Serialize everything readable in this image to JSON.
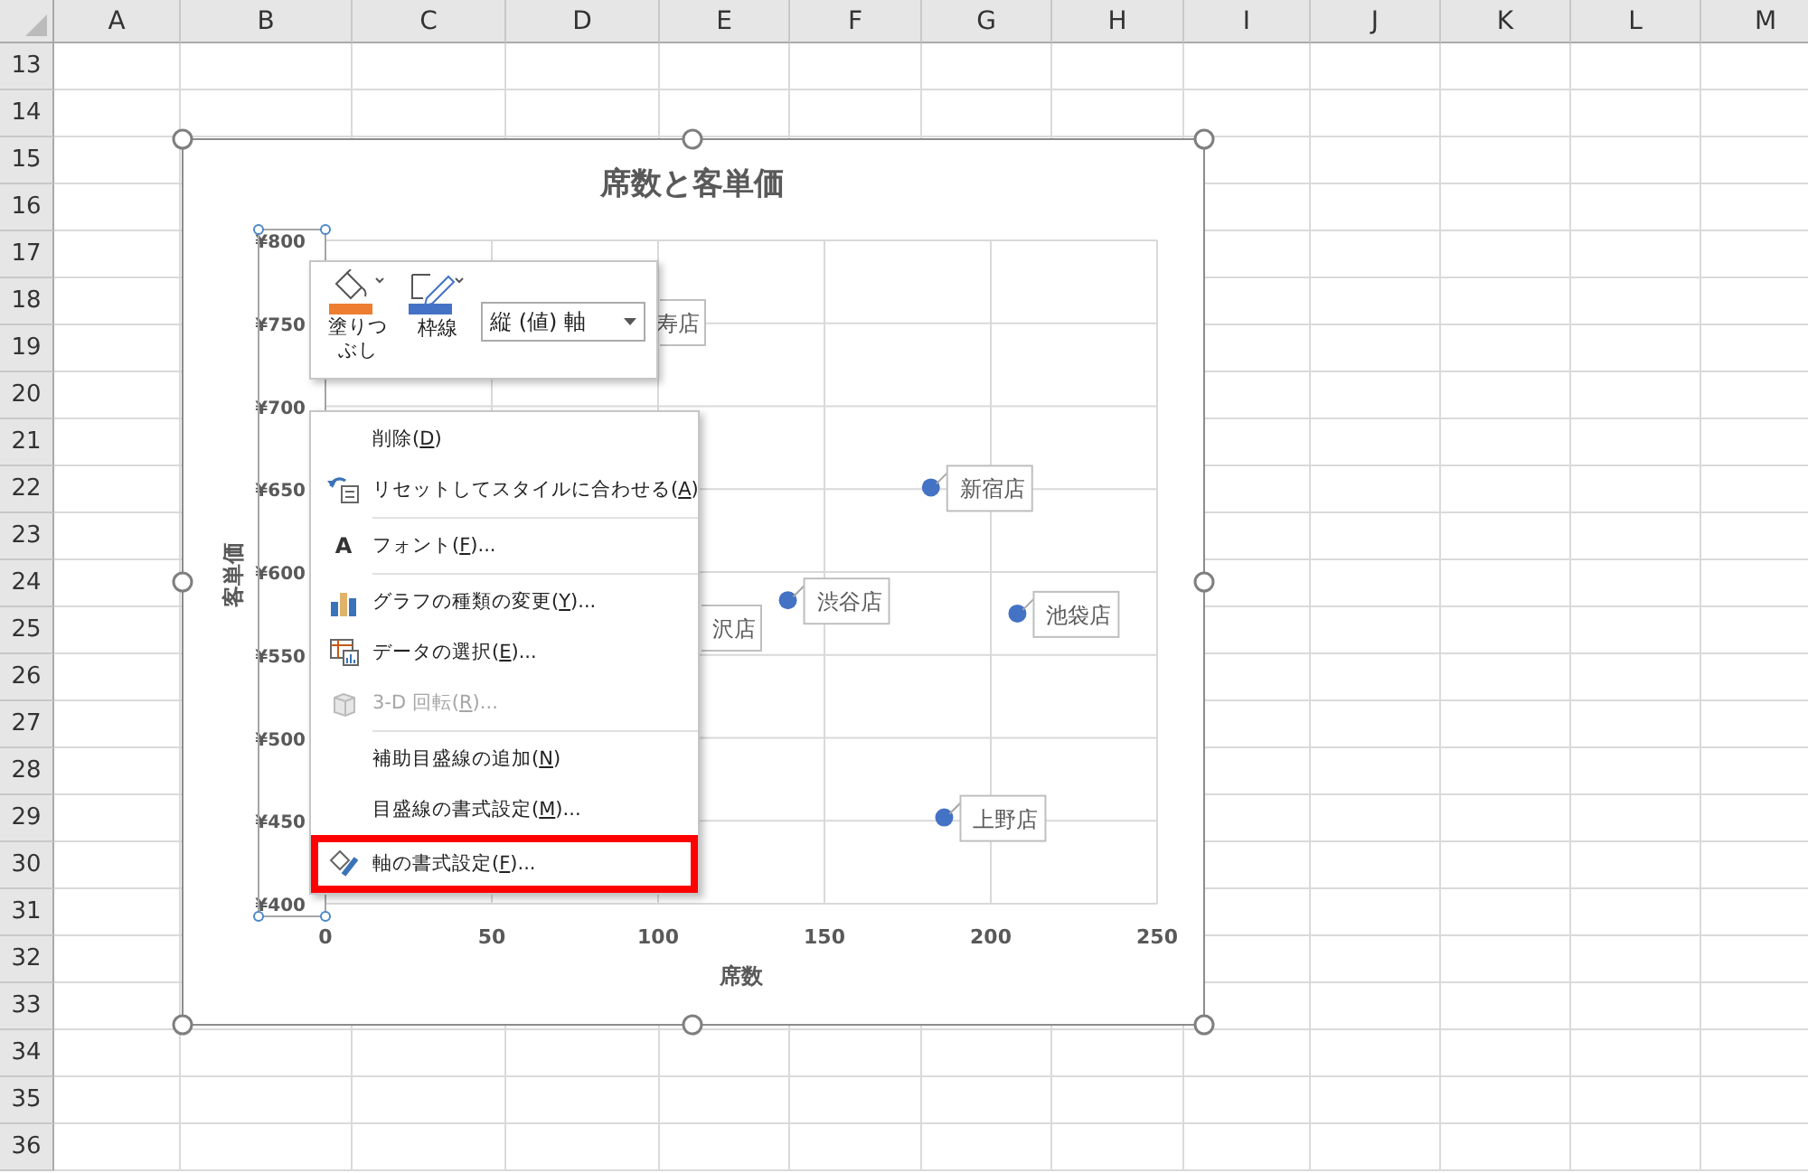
{
  "sheet": {
    "columns": [
      "A",
      "B",
      "C",
      "D",
      "E",
      "F",
      "G",
      "H",
      "I",
      "J",
      "K",
      "L",
      "M"
    ],
    "rows": [
      "13",
      "14",
      "15",
      "16",
      "17",
      "18",
      "19",
      "20",
      "21",
      "22",
      "23",
      "24",
      "25",
      "26",
      "27",
      "28",
      "29",
      "30",
      "31",
      "32",
      "33",
      "34",
      "35",
      "36"
    ]
  },
  "chart": {
    "selected": true,
    "axis_selected": true,
    "chart_data": {
      "type": "scatter",
      "title": "席数と客単価",
      "xlabel": "席数",
      "ylabel": "客単価",
      "xlim": [
        0,
        250
      ],
      "ylim": [
        400,
        800
      ],
      "xticks": [
        0,
        50,
        100,
        150,
        200,
        250
      ],
      "yticks": [
        {
          "value": 400,
          "label": "¥400"
        },
        {
          "value": 450,
          "label": "¥450"
        },
        {
          "value": 500,
          "label": "¥500"
        },
        {
          "value": 550,
          "label": "¥550"
        },
        {
          "value": 600,
          "label": "¥600"
        },
        {
          "value": 650,
          "label": "¥650"
        },
        {
          "value": 700,
          "label": "¥700"
        },
        {
          "value": 750,
          "label": "¥750"
        },
        {
          "value": 800,
          "label": "¥800"
        }
      ],
      "x": [
        182,
        139,
        208,
        186
      ],
      "grid": true,
      "series": [
        {
          "color": "#4472c4",
          "values": [
            651,
            583,
            575,
            452
          ]
        }
      ],
      "value_labels": [
        "新宿店",
        "渋谷店",
        "池袋店",
        "上野店"
      ],
      "annotations": [
        "寿店",
        "沢店"
      ]
    }
  },
  "mini_toolbar": {
    "fill": {
      "label": "塗りつぶし",
      "color": "#ed7d31"
    },
    "outline": {
      "label": "枠線",
      "color": "#4472c4"
    },
    "element_dropdown": {
      "value": "縦 (値) 軸"
    }
  },
  "context_menu": {
    "items": [
      {
        "kind": "item",
        "before": "削除(",
        "key": "D",
        "after": ")",
        "disabled": false,
        "highlighted": false
      },
      {
        "kind": "item",
        "before": "リセットしてスタイルに合わせる(",
        "key": "A",
        "after": ")",
        "disabled": false,
        "highlighted": false
      },
      {
        "kind": "separator"
      },
      {
        "kind": "item",
        "icon_text": "A",
        "before": "フォント(",
        "key": "F",
        "after": ")...",
        "disabled": false,
        "highlighted": false
      },
      {
        "kind": "separator"
      },
      {
        "kind": "item",
        "before": "グラフの種類の変更(",
        "key": "Y",
        "after": ")...",
        "disabled": false,
        "highlighted": false
      },
      {
        "kind": "item",
        "before": "データの選択(",
        "key": "E",
        "after": ")...",
        "disabled": false,
        "highlighted": false
      },
      {
        "kind": "item",
        "before": "3-D 回転(",
        "key": "R",
        "after": ")...",
        "disabled": true,
        "highlighted": false
      },
      {
        "kind": "separator"
      },
      {
        "kind": "item",
        "before": "補助目盛線の追加(",
        "key": "N",
        "after": ")",
        "disabled": false,
        "highlighted": false
      },
      {
        "kind": "item",
        "before": "目盛線の書式設定(",
        "key": "M",
        "after": ")...",
        "disabled": false,
        "highlighted": false
      },
      {
        "kind": "item",
        "before": "軸の書式設定(",
        "key": "F",
        "after": ")...",
        "disabled": false,
        "highlighted": true
      }
    ]
  }
}
